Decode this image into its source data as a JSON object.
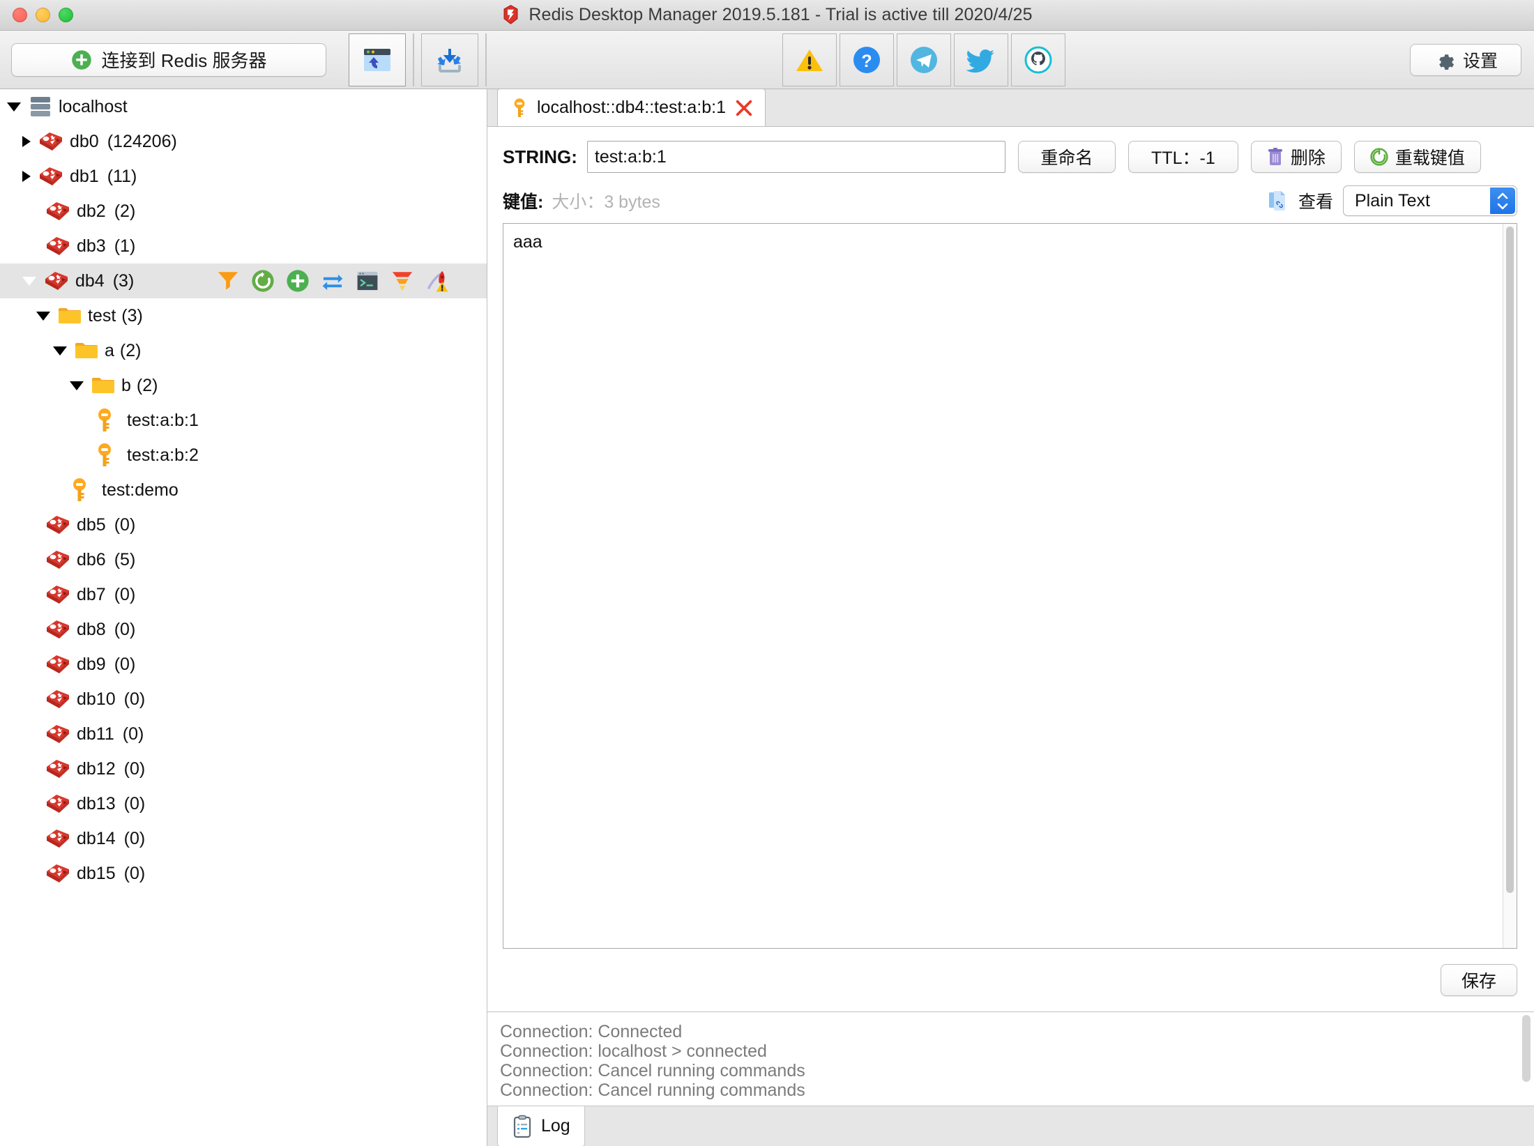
{
  "window": {
    "title": "Redis Desktop Manager 2019.5.181  -  Trial is active till 2020/4/25",
    "logo_icon": "redis-logo-icon"
  },
  "toolbar": {
    "connect_label": "连接到 Redis 服务器",
    "connect_icon": "plus-circle-icon",
    "import_connections_icon": "import-connections-icon",
    "import_icon": "download-import-icon",
    "warning_icon": "warning-triangle-icon",
    "help_icon": "question-circle-icon",
    "telegram_icon": "telegram-icon",
    "twitter_icon": "twitter-icon",
    "github_icon": "github-icon",
    "settings_label": "设置",
    "settings_icon": "gear-icon"
  },
  "sidebar": {
    "server": {
      "label": "localhost",
      "icon": "server-icon",
      "expanded": true
    },
    "databases": [
      {
        "label": "db0",
        "count": "(124206)",
        "state": "collapsed"
      },
      {
        "label": "db1",
        "count": "(11)",
        "state": "collapsed"
      },
      {
        "label": "db2",
        "count": "(2)",
        "state": "leaf"
      },
      {
        "label": "db3",
        "count": "(1)",
        "state": "leaf"
      },
      {
        "label": "db4",
        "count": "(3)",
        "state": "expanded",
        "selected": true
      },
      {
        "label": "db5",
        "count": "(0)",
        "state": "leaf"
      },
      {
        "label": "db6",
        "count": "(5)",
        "state": "leaf"
      },
      {
        "label": "db7",
        "count": "(0)",
        "state": "leaf"
      },
      {
        "label": "db8",
        "count": "(0)",
        "state": "leaf"
      },
      {
        "label": "db9",
        "count": "(0)",
        "state": "leaf"
      },
      {
        "label": "db10",
        "count": "(0)",
        "state": "leaf"
      },
      {
        "label": "db11",
        "count": "(0)",
        "state": "leaf"
      },
      {
        "label": "db12",
        "count": "(0)",
        "state": "leaf"
      },
      {
        "label": "db13",
        "count": "(0)",
        "state": "leaf"
      },
      {
        "label": "db14",
        "count": "(0)",
        "state": "leaf"
      },
      {
        "label": "db15",
        "count": "(0)",
        "state": "leaf"
      }
    ],
    "db4_actions": [
      "filter-icon",
      "reload-icon",
      "add-key-icon",
      "live-update-icon",
      "console-icon",
      "bulk-operations-icon",
      "flush-db-icon"
    ],
    "keys_tree": {
      "folder_test": {
        "label": "test",
        "count": "(3)"
      },
      "folder_a": {
        "label": "a",
        "count": "(2)"
      },
      "folder_b": {
        "label": "b",
        "count": "(2)"
      },
      "key_1": {
        "label": "test:a:b:1"
      },
      "key_2": {
        "label": "test:a:b:2"
      },
      "key_demo": {
        "label": "test:demo"
      }
    }
  },
  "main": {
    "tab": {
      "label": "localhost::db4::test:a:b:1",
      "icon": "key-icon",
      "close_icon": "close-icon"
    },
    "key": {
      "type_label": "STRING:",
      "name_value": "test:a:b:1",
      "rename_label": "重命名",
      "ttl_label": "TTL：-1",
      "delete_label": "删除",
      "delete_icon": "trash-icon",
      "reload_label": "重载键值",
      "reload_icon": "reload-icon"
    },
    "value": {
      "label": "键值:",
      "size_label": "大小：3 bytes",
      "view_label": "查看",
      "view_icon": "document-link-icon",
      "format_selected": "Plain Text",
      "content": "aaa",
      "save_label": "保存"
    }
  },
  "log": {
    "lines": [
      "Connection: Connected",
      "Connection: localhost > connected",
      "Connection: Cancel running commands",
      "Connection: Cancel running commands"
    ],
    "tab_label": "Log",
    "tab_icon": "clipboard-icon"
  },
  "colors": {
    "redis_red": "#d32b21",
    "key_orange": "#ffa91e",
    "folder_yellow": "#fdc42a",
    "accent_blue": "#2b80e8",
    "green": "#4caf50"
  }
}
